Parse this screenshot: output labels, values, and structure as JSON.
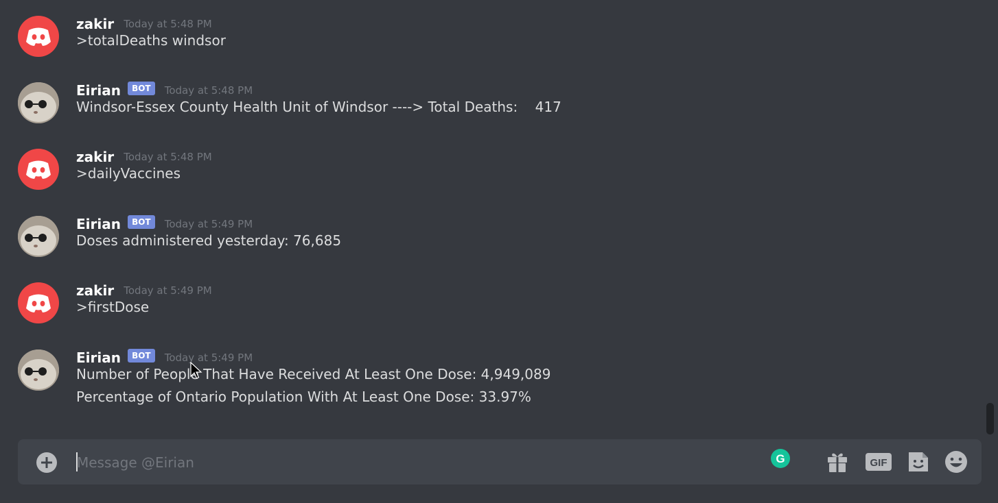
{
  "messages": [
    {
      "username": "zakir",
      "bot": false,
      "timestamp": "Today at 5:48 PM",
      "lines": [
        ">totalDeaths windsor"
      ]
    },
    {
      "username": "Eirian",
      "bot": true,
      "bot_tag": "BOT",
      "timestamp": "Today at 5:48 PM",
      "lines": [
        "Windsor-Essex County Health Unit of Windsor ----> Total Deaths:    417"
      ]
    },
    {
      "username": "zakir",
      "bot": false,
      "timestamp": "Today at 5:48 PM",
      "lines": [
        ">dailyVaccines"
      ]
    },
    {
      "username": "Eirian",
      "bot": true,
      "bot_tag": "BOT",
      "timestamp": "Today at 5:49 PM",
      "lines": [
        "Doses administered yesterday: 76,685"
      ]
    },
    {
      "username": "zakir",
      "bot": false,
      "timestamp": "Today at 5:49 PM",
      "lines": [
        ">firstDose"
      ]
    },
    {
      "username": "Eirian",
      "bot": true,
      "bot_tag": "BOT",
      "timestamp": "Today at 5:49 PM",
      "lines": [
        "Number of People That Have Received At Least One Dose: 4,949,089",
        "Percentage of Ontario Population With At Least One Dose: 33.97%"
      ]
    }
  ],
  "composer": {
    "placeholder": "Message @Eirian",
    "value": "",
    "gif_label": "GIF",
    "grammarly_letter": "G"
  },
  "icons": {
    "attach": "plus-circle-icon",
    "gift": "gift-icon",
    "gif": "gif-icon",
    "sticker": "sticker-icon",
    "emoji": "emoji-icon",
    "grammarly": "grammarly-icon"
  },
  "colors": {
    "background": "#36393f",
    "composer": "#40444b",
    "bot_tag": "#7289da",
    "discord_avatar": "#f04747",
    "grammarly": "#15c39a"
  }
}
